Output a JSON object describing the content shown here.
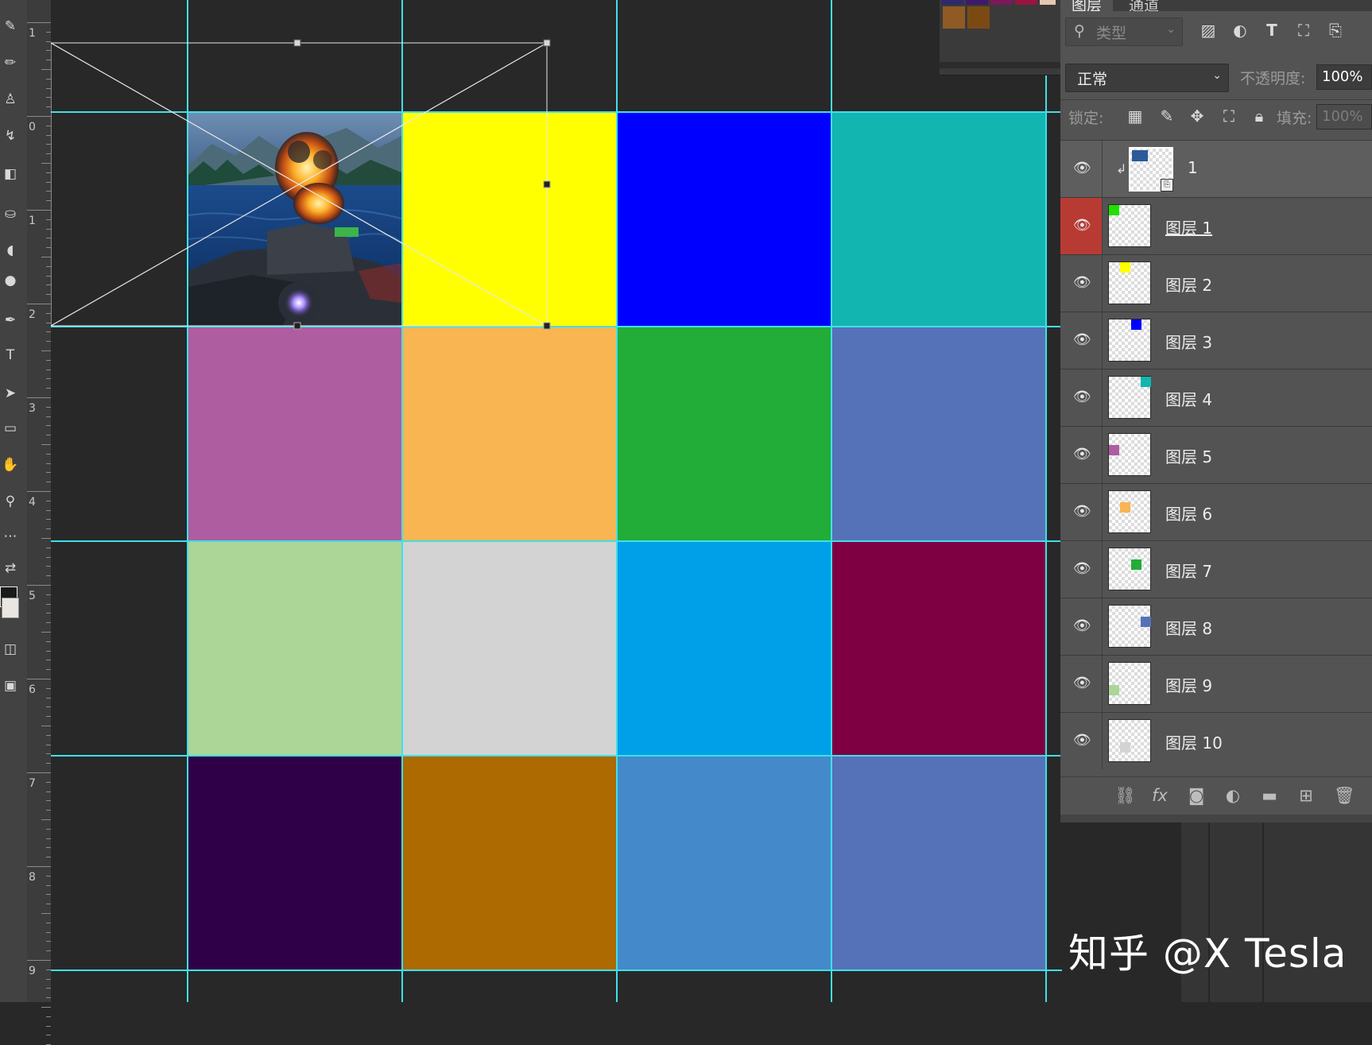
{
  "layers_panel": {
    "tabs": [
      {
        "label": "图层",
        "active": true
      },
      {
        "label": "通道",
        "active": false
      }
    ],
    "filter_placeholder": "类型",
    "blend_mode": "正常",
    "opacity_label": "不透明度:",
    "opacity_value": "100%",
    "lock_label": "锁定:",
    "fill_label": "填充:",
    "fill_value": "100%",
    "layers": [
      {
        "name": "1",
        "type": "smart-object",
        "visible": true,
        "selected": true
      },
      {
        "name": "图层 1",
        "color": "#22e000",
        "visible": true,
        "active": true
      },
      {
        "name": "图层 2",
        "color": "#ffff00",
        "visible": true
      },
      {
        "name": "图层 3",
        "color": "#0000ff",
        "visible": true
      },
      {
        "name": "图层 4",
        "color": "#13b5b1",
        "visible": true
      },
      {
        "name": "图层 5",
        "color": "#ae5da1",
        "visible": true
      },
      {
        "name": "图层 6",
        "color": "#f8b551",
        "visible": true
      },
      {
        "name": "图层 7",
        "color": "#22ac38",
        "visible": true
      },
      {
        "name": "图层 8",
        "color": "#5572b8",
        "visible": true
      },
      {
        "name": "图层 9",
        "color": "#acd598",
        "visible": true
      },
      {
        "name": "图层 10",
        "color": "#d3d3d3",
        "visible": true
      }
    ]
  },
  "ruler": {
    "labels": [
      "1",
      "0",
      "1",
      "2",
      "3",
      "4",
      "5",
      "6",
      "7",
      "8",
      "9"
    ]
  },
  "canvas": {
    "tiles": [
      {
        "color": "image"
      },
      {
        "color": "#ffff00"
      },
      {
        "color": "#0000ff"
      },
      {
        "color": "#13b5b1"
      },
      {
        "color": "#ae5da1"
      },
      {
        "color": "#f8b551"
      },
      {
        "color": "#22ac38"
      },
      {
        "color": "#5572b8"
      },
      {
        "color": "#acd598"
      },
      {
        "color": "#d3d3d3"
      },
      {
        "color": "#00a0e9"
      },
      {
        "color": "#7e0042"
      },
      {
        "color": "#2f0047"
      },
      {
        "color": "#ac6a00"
      },
      {
        "color": "#448aca"
      },
      {
        "color": "#5572b8"
      }
    ],
    "guide_color": "#3fe0e8"
  },
  "watermark": "知乎 @X Tesla"
}
